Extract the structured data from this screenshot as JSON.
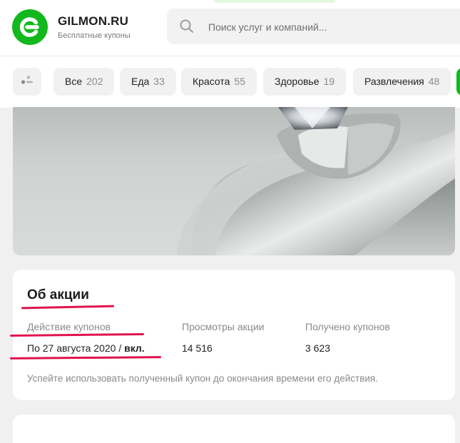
{
  "brand": {
    "name": "GILMON.RU",
    "tagline": "Бесплатные купоны",
    "color": "#13b81d"
  },
  "search": {
    "placeholder": "Поиск услуг и компаний..."
  },
  "categories": [
    {
      "label": "Все",
      "count": "202"
    },
    {
      "label": "Еда",
      "count": "33"
    },
    {
      "label": "Красота",
      "count": "55"
    },
    {
      "label": "Здоровье",
      "count": "19"
    },
    {
      "label": "Развлечения",
      "count": "48"
    }
  ],
  "hero": {
    "icon": "ring-photo"
  },
  "about": {
    "title": "Об акции",
    "validity_label": "Действие купонов",
    "validity_value": "По 27 августа 2020 / ",
    "validity_suffix": "вкл.",
    "views_label": "Просмотры акции",
    "views_value": "14 516",
    "received_label": "Получено купонов",
    "received_value": "3 623",
    "note": "Успейте использовать полученный купон до окончания времени его действия."
  },
  "colors": {
    "accent": "#13b81d",
    "annotation": "#e0134e"
  }
}
